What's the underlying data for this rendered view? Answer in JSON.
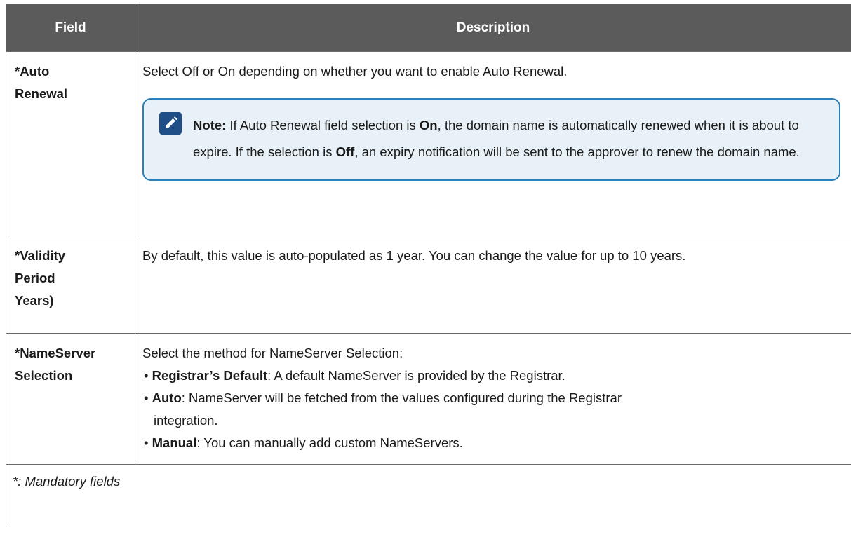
{
  "table": {
    "header": {
      "field": "Field",
      "description": "Description"
    },
    "rows": [
      {
        "field_line1": "*Auto",
        "field_line2": "Renewal",
        "description": "Select Off or On depending on whether you want to enable Auto Renewal.",
        "note": {
          "label": "Note:",
          "text_1": " If Auto Renewal field selection is ",
          "bold_on": "On",
          "text_2": ", the domain name is automatically renewed when it is about to expire. If the selection is ",
          "bold_off": "Off",
          "text_3": ", an expiry notification will be sent to the approver to renew the domain name."
        }
      },
      {
        "field_line1": "*Validity",
        "field_line2": "Period",
        "field_line3": "Years)",
        "description": "By default, this value is auto-populated as 1 year. You can change the value for up to 10 years."
      },
      {
        "field_line1": "*NameServer",
        "field_line2": "Selection",
        "intro": "Select the method for NameServer Selection:",
        "bullets": [
          {
            "marker": "• ",
            "term": "Registrar’s Default",
            "text": ": A default NameServer is provided by the Registrar."
          },
          {
            "marker": "• ",
            "term": "Auto",
            "text": ": NameServer will be fetched from the values configured during the Registrar",
            "continuation": "integration."
          },
          {
            "marker": "• ",
            "term": "Manual",
            "text": ": You can manually add custom NameServers."
          }
        ]
      }
    ],
    "footnote": "*: Mandatory fields"
  },
  "colors": {
    "header_bg": "#5b5b5b",
    "note_border": "#2a80b9",
    "note_bg": "#e7f1f7",
    "note_icon_bg": "#1f4f86"
  },
  "icons": {
    "note": "pencil-edit-icon"
  }
}
